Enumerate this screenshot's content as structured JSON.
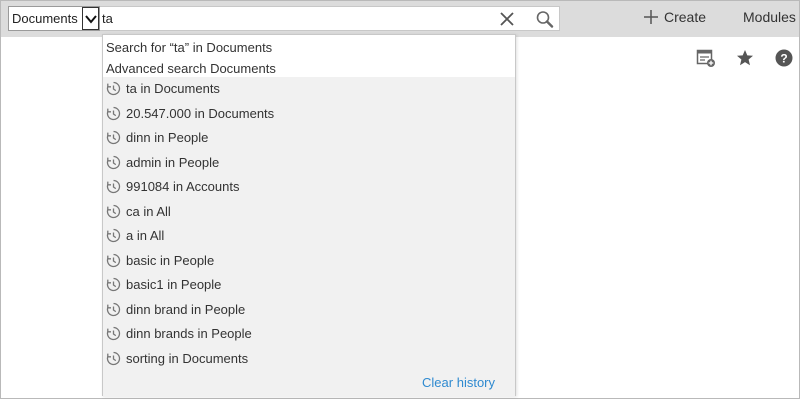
{
  "scope_select": {
    "value": "Documents"
  },
  "search": {
    "value": "ta"
  },
  "header": {
    "create_label": "Create",
    "modules_label": "Modules"
  },
  "dropdown": {
    "search_for": "Search for “ta” in Documents",
    "advanced_search": "Advanced search Documents",
    "history": [
      {
        "label": "ta in Documents"
      },
      {
        "label": "20.547.000 in Documents"
      },
      {
        "label": "dinn in People"
      },
      {
        "label": "admin in People"
      },
      {
        "label": "991084 in Accounts"
      },
      {
        "label": "ca in All"
      },
      {
        "label": "a in All"
      },
      {
        "label": "basic in People"
      },
      {
        "label": "basic1 in People"
      },
      {
        "label": "dinn brand in People"
      },
      {
        "label": "dinn brands in People"
      },
      {
        "label": "sorting in Documents"
      }
    ],
    "clear_history": "Clear history"
  },
  "icons": {
    "scope_chevron": "chevron-down-icon",
    "clear": "close-icon",
    "search": "search-icon",
    "create": "plus-icon",
    "history": "history-icon",
    "add_widget": "add-widget-icon",
    "favorite": "star-icon",
    "help": "help-icon"
  },
  "colors": {
    "link": "#2f8ad0",
    "topbar": "#dcdcdc",
    "history_bg": "#f1f1f1"
  }
}
